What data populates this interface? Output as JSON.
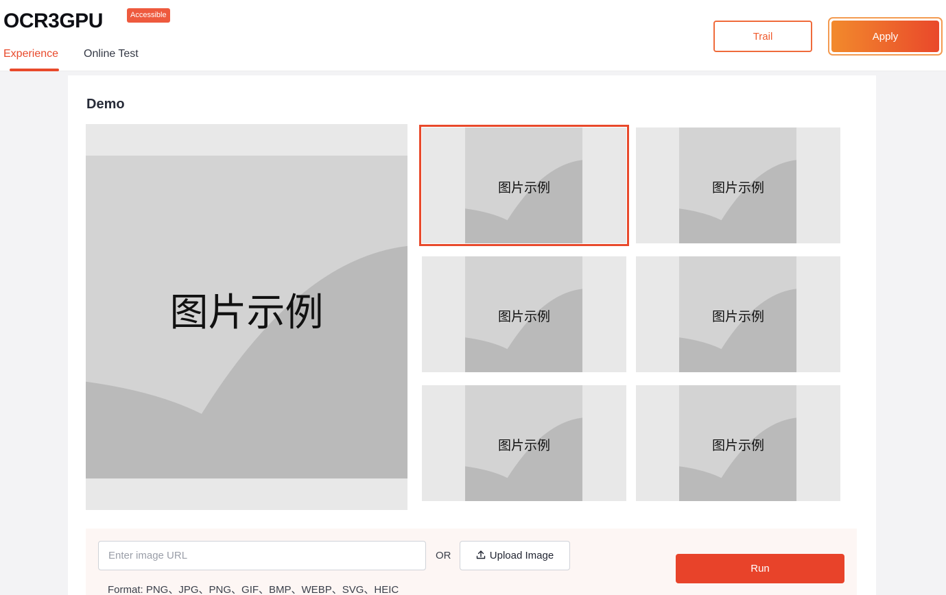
{
  "header": {
    "logo": "OCR3GPU",
    "badge": "Accessible",
    "tabs": [
      {
        "label": "Experience",
        "active": true
      },
      {
        "label": "Online Test",
        "active": false
      }
    ],
    "trail_label": "Trail",
    "apply_label": "Apply"
  },
  "demo": {
    "title": "Demo",
    "main_image_label": "图片示例",
    "thumbnails": [
      {
        "label": "图片示例",
        "selected": true
      },
      {
        "label": "图片示例",
        "selected": false
      },
      {
        "label": "图片示例",
        "selected": false
      },
      {
        "label": "图片示例",
        "selected": false
      },
      {
        "label": "图片示例",
        "selected": false
      },
      {
        "label": "图片示例",
        "selected": false
      }
    ]
  },
  "input": {
    "url_placeholder": "Enter image URL",
    "url_value": "",
    "or_text": "OR",
    "upload_label": "Upload Image",
    "upload_icon": "upload-icon",
    "run_label": "Run",
    "format_text": "Format: PNG、JPG、PNG、GIF、BMP、WEBP、SVG、HEIC"
  },
  "colors": {
    "accent": "#e8492b",
    "apply_gradient_start": "#f28a2c",
    "apply_gradient_end": "#e9482b",
    "placeholder_outer": "#e8e8e8",
    "placeholder_inner": "#d3d3d3",
    "placeholder_hill": "#bababa"
  }
}
